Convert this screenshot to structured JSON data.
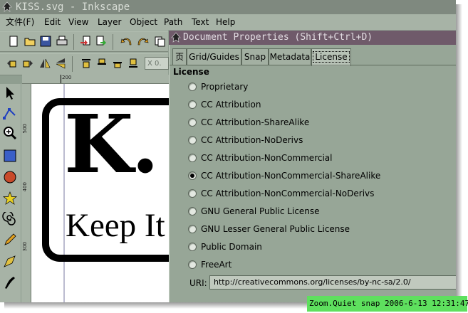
{
  "window": {
    "title": "KISS.svg - Inkscape"
  },
  "menu": {
    "items": [
      "文件(F)",
      "Edit",
      "View",
      "Layer",
      "Object",
      "Path",
      "Text",
      "Help"
    ]
  },
  "toolbar": {
    "x_field_label": "X",
    "x_field_value": "0."
  },
  "rulers": {
    "h_tick": "200",
    "v_ticks": [
      "500",
      "400",
      "300"
    ]
  },
  "canvas": {
    "big_text": "K.",
    "keep_text": "Keep It"
  },
  "dialog": {
    "title": "Document Properties (Shift+Ctrl+D)",
    "tabs": [
      {
        "label": "页"
      },
      {
        "label": "Grid/Guides"
      },
      {
        "label": "Snap"
      },
      {
        "label": "Metadata"
      },
      {
        "label": "License"
      }
    ],
    "active_tab": "License",
    "section_label": "License",
    "options": [
      {
        "label": "Proprietary",
        "selected": false
      },
      {
        "label": "CC Attribution",
        "selected": false
      },
      {
        "label": "CC Attribution-ShareAlike",
        "selected": false
      },
      {
        "label": "CC Attribution-NoDerivs",
        "selected": false
      },
      {
        "label": "CC Attribution-NonCommercial",
        "selected": false
      },
      {
        "label": "CC Attribution-NonCommercial-ShareAlike",
        "selected": true
      },
      {
        "label": "CC Attribution-NonCommercial-NoDerivs",
        "selected": false
      },
      {
        "label": "GNU General Public License",
        "selected": false
      },
      {
        "label": "GNU Lesser General Public License",
        "selected": false
      },
      {
        "label": "Public Domain",
        "selected": false
      },
      {
        "label": "FreeArt",
        "selected": false
      }
    ],
    "uri_label": "URI:",
    "uri_value": "http://creativecommons.org/licenses/by-nc-sa/2.0/"
  },
  "watermark": {
    "text": "Zoom.Quiet snap 2006-6-13 12:31:47"
  },
  "colors": {
    "window_bg": "#8f9e90",
    "dialog_title_bg": "#6f5a6a",
    "watermark_bg": "#5ee05e"
  }
}
